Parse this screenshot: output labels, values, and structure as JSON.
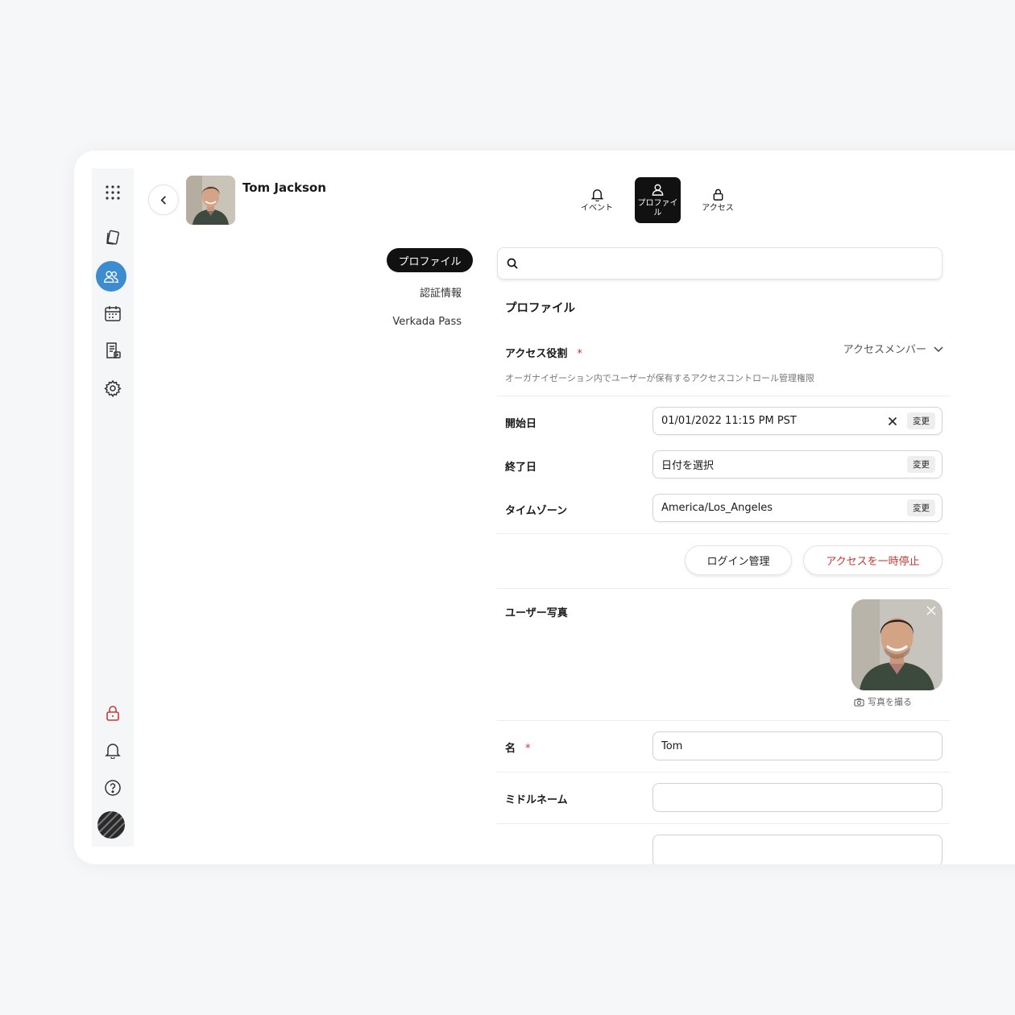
{
  "user": {
    "name": "Tom Jackson"
  },
  "tabs": [
    {
      "label": "イベント",
      "icon": "bell-icon",
      "active": false
    },
    {
      "label": "プロファイル",
      "icon": "user-icon",
      "active": true
    },
    {
      "label": "アクセス",
      "icon": "lock-icon",
      "active": false
    }
  ],
  "side_nav": [
    {
      "label": "プロファイル",
      "active": true
    },
    {
      "label": "認証情報",
      "active": false
    },
    {
      "label": "Verkada Pass",
      "active": false
    }
  ],
  "search": {
    "placeholder": "",
    "value": ""
  },
  "profile": {
    "title": "プロファイル",
    "access_role": {
      "label": "アクセス役割",
      "required_mark": "*",
      "value": "アクセスメンバー",
      "description": "オーガナイゼーション内でユーザーが保有するアクセスコントロール管理権限"
    },
    "start_date": {
      "label": "開始日",
      "value": "01/01/2022 11:15 PM PST",
      "change": "変更"
    },
    "end_date": {
      "label": "終了日",
      "value": "日付を選択",
      "change": "変更"
    },
    "timezone": {
      "label": "タイムゾーン",
      "value": "America/Los_Angeles",
      "change": "変更"
    },
    "buttons": {
      "login_manage": "ログイン管理",
      "pause_access": "アクセスを一時停止"
    },
    "user_photo": {
      "label": "ユーザー写真",
      "take_photo": "写真を撮る"
    },
    "first_name": {
      "label": "名",
      "required_mark": "*",
      "value": "Tom"
    },
    "middle_name": {
      "label": "ミドルネーム",
      "value": ""
    }
  },
  "colors": {
    "accent": "#3d8cd0",
    "danger": "#c53a34",
    "dark": "#111111"
  },
  "rail_icons": [
    "grid-icon",
    "cards-icon",
    "users-icon",
    "calendar-icon",
    "report-icon",
    "gear-icon",
    "lock-icon",
    "bell-icon",
    "help-icon"
  ]
}
